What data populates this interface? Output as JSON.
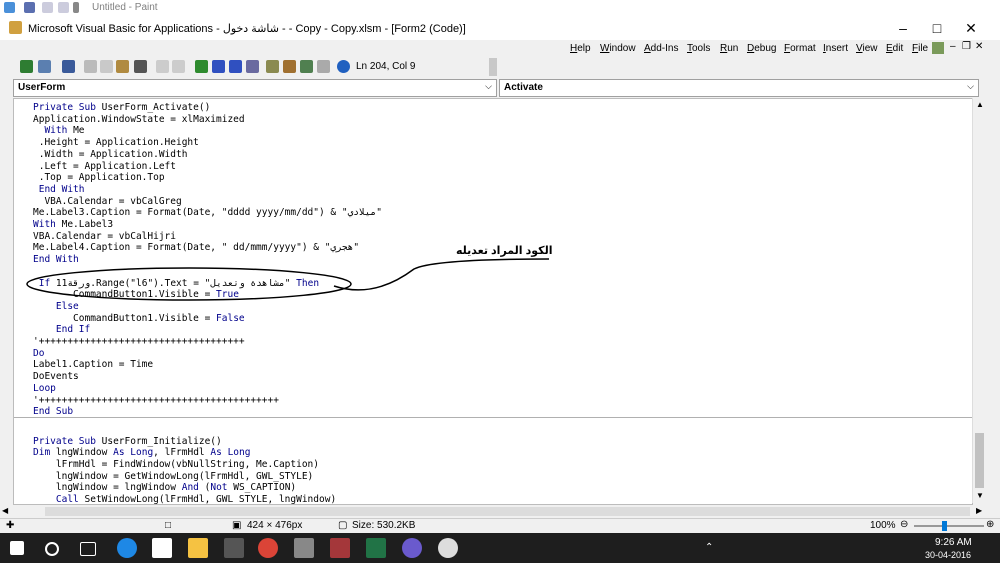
{
  "paint": {
    "title": "Untitled - Paint"
  },
  "window": {
    "title": "Microsoft Visual Basic for Applications - شاشة دخول - - Copy - Copy.xlsm - [Form2 (Code)]"
  },
  "menu": [
    "Help",
    "Window",
    "Add-Ins",
    "Tools",
    "Run",
    "Debug",
    "Format",
    "Insert",
    "View",
    "Edit",
    "File"
  ],
  "toolbar": {
    "status": "Ln 204, Col 9"
  },
  "combos": {
    "object": "UserForm",
    "procedure": "Activate"
  },
  "code_lines": [
    "Private Sub UserForm_Activate()",
    "Application.WindowState = xlMaximized",
    "  With Me",
    " .Height = Application.Height",
    " .Width = Application.Width",
    " .Left = Application.Left",
    " .Top = Application.Top",
    " End With",
    "  VBA.Calendar = vbCalGreg",
    "Me.Label3.Caption = Format(Date, \"dddd yyyy/mm/dd\") & \"ميلادي\"",
    "With Me.Label3",
    "VBA.Calendar = vbCalHijri",
    "Me.Label4.Caption = Format(Date, \" dd/mmm/yyyy\") & \"هجري\"",
    "End With",
    "",
    " If 11ورقة.Range(\"l6\").Text = \"مشاهدة وتعديل\" Then",
    "       CommandButton1.Visible = True",
    "    Else",
    "       CommandButton1.Visible = False",
    "    End If",
    "'++++++++++++++++++++++++++++++++++++",
    "Do",
    "Label1.Caption = Time",
    "DoEvents",
    "Loop",
    "'++++++++++++++++++++++++++++++++++++++++++",
    "End Sub",
    "",
    "Private Sub UserForm_Initialize()",
    "Dim lngWindow As Long, lFrmHdl As Long",
    "    lFrmHdl = FindWindow(vbNullString, Me.Caption)",
    "    lngWindow = GetWindowLong(lFrmHdl, GWL_STYLE)",
    "    lngWindow = lngWindow And (Not WS_CAPTION)",
    "    Call SetWindowLong(lFrmHdl, GWL_STYLE, lngWindow)"
  ],
  "annotation": "الكود المراد تعديله",
  "status": {
    "dims": "424 × 476px",
    "size": "Size: 530.2KB",
    "zoom": "100%"
  },
  "clock": {
    "time": "9:26 AM",
    "date": "30-04-2016"
  },
  "colors": {
    "accent": "#0078d7",
    "keyword": "#00008b",
    "annot": "#000000"
  }
}
